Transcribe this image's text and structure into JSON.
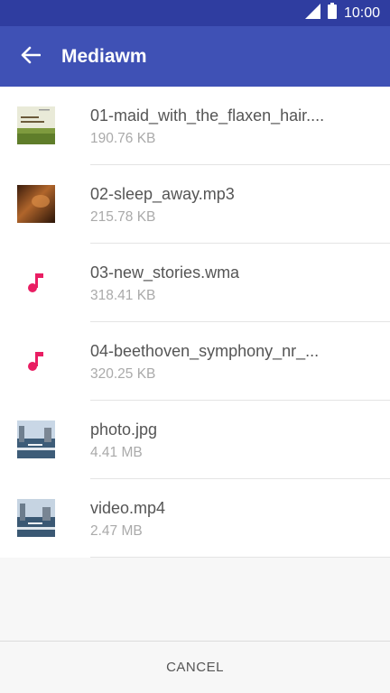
{
  "status_bar": {
    "time": "10:00",
    "icons": [
      "signal-icon",
      "battery-icon"
    ]
  },
  "app_bar": {
    "back_icon": "arrow-left-icon",
    "title": "Mediawm"
  },
  "files": [
    {
      "name": "01-maid_with_the_flaxen_hair....",
      "size": "190.76 KB",
      "thumb": "album-cover-stoltzman"
    },
    {
      "name": "02-sleep_away.mp3",
      "size": "215.78 KB",
      "thumb": "album-cover-brown"
    },
    {
      "name": "03-new_stories.wma",
      "size": "318.41 KB",
      "thumb": "music-note-icon"
    },
    {
      "name": "04-beethoven_symphony_nr_...",
      "size": "320.25 KB",
      "thumb": "music-note-icon"
    },
    {
      "name": "photo.jpg",
      "size": "4.41 MB",
      "thumb": "photo-thumbnail"
    },
    {
      "name": "video.mp4",
      "size": "2.47 MB",
      "thumb": "video-thumbnail"
    }
  ],
  "colors": {
    "status_bar": "#2f3da0",
    "app_bar": "#3f51b5",
    "music_note": "#e91e63"
  },
  "cancel_label": "CANCEL"
}
